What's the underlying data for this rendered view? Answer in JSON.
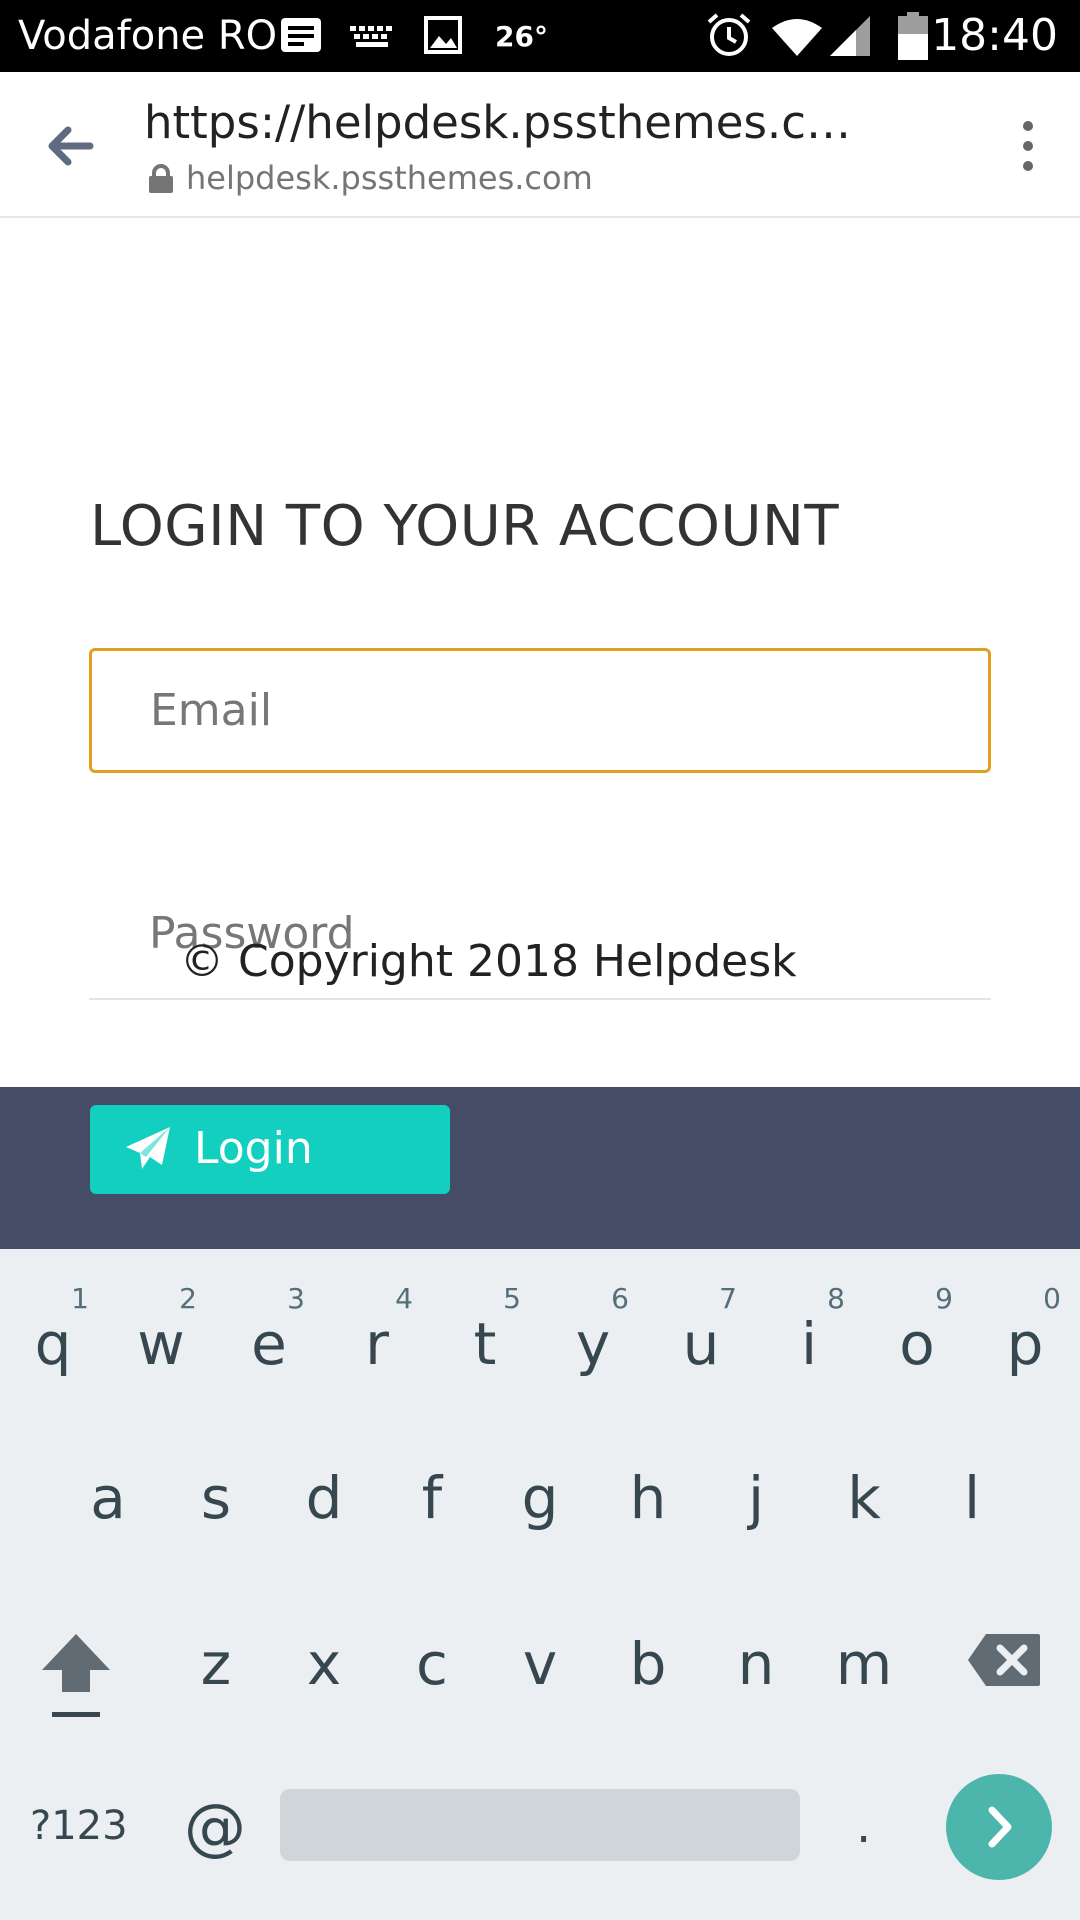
{
  "status_bar": {
    "carrier": "Vodafone RO",
    "temperature": "26°",
    "time": "18:40"
  },
  "browser": {
    "url_title": "https://helpdesk.pssthemes.co…",
    "domain": "helpdesk.pssthemes.com"
  },
  "page": {
    "title": "LOGIN TO YOUR ACCOUNT",
    "email_placeholder": "Email",
    "password_placeholder": "Password",
    "copyright": "© Copyright 2018 Helpdesk",
    "login_label": "Login"
  },
  "colors": {
    "login_button": "#12cfbf",
    "footer_band": "#454c66",
    "email_focus_border": "#e0a020"
  },
  "keyboard": {
    "row1": [
      {
        "ch": "q",
        "num": "1"
      },
      {
        "ch": "w",
        "num": "2"
      },
      {
        "ch": "e",
        "num": "3"
      },
      {
        "ch": "r",
        "num": "4"
      },
      {
        "ch": "t",
        "num": "5"
      },
      {
        "ch": "y",
        "num": "6"
      },
      {
        "ch": "u",
        "num": "7"
      },
      {
        "ch": "i",
        "num": "8"
      },
      {
        "ch": "o",
        "num": "9"
      },
      {
        "ch": "p",
        "num": "0"
      }
    ],
    "row2": [
      "a",
      "s",
      "d",
      "f",
      "g",
      "h",
      "j",
      "k",
      "l"
    ],
    "row3": [
      "z",
      "x",
      "c",
      "v",
      "b",
      "n",
      "m"
    ],
    "symbols_label": "?123",
    "at_label": "@",
    "period_label": "."
  }
}
